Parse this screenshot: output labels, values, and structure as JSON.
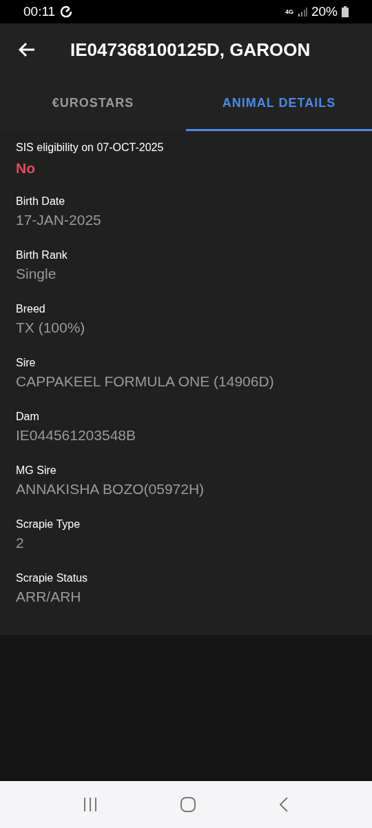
{
  "status_bar": {
    "time": "00:11",
    "network": "4G",
    "battery": "20%"
  },
  "header": {
    "title": "IE047368100125D, GAROON"
  },
  "tabs": [
    {
      "label": "€UROSTARS",
      "selected": false
    },
    {
      "label": "ANIMAL DETAILS",
      "selected": true
    }
  ],
  "eligibility": {
    "label": "SIS eligibility on 07-OCT-2025",
    "value": "No",
    "eligible": false
  },
  "details": [
    {
      "label": "Birth Date",
      "value": "17-JAN-2025"
    },
    {
      "label": "Birth Rank",
      "value": "Single"
    },
    {
      "label": "Breed",
      "value": "TX (100%)"
    },
    {
      "label": "Sire",
      "value": "CAPPAKEEL FORMULA ONE (14906D)"
    },
    {
      "label": "Dam",
      "value": "IE044561203548B"
    },
    {
      "label": "MG Sire",
      "value": "ANNAKISHA BOZO(05972H)"
    },
    {
      "label": "Scrapie Type",
      "value": "2"
    },
    {
      "label": "Scrapie Status",
      "value": "ARR/ARH"
    }
  ]
}
